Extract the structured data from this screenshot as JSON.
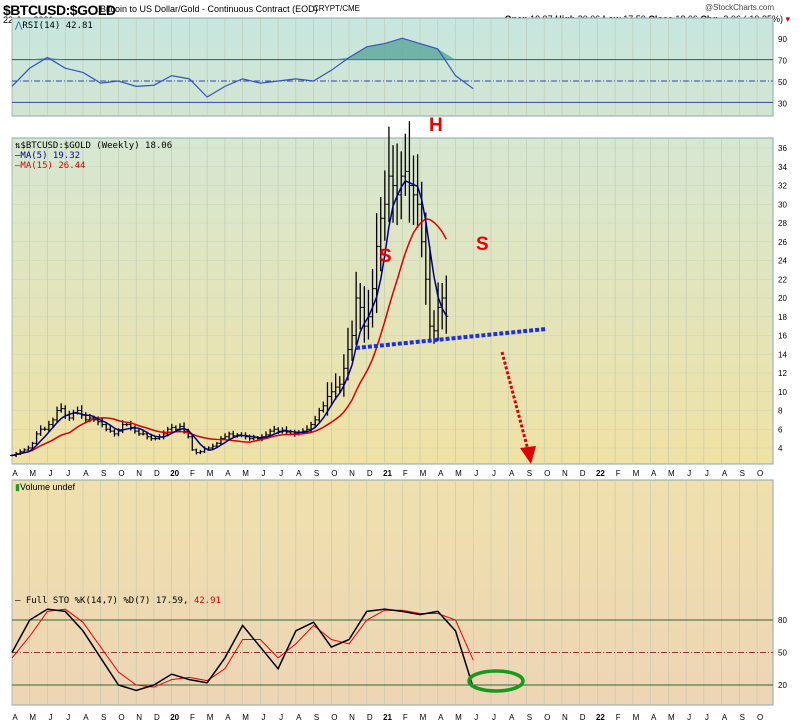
{
  "header": {
    "symbol": "$BTCUSD:$GOLD",
    "description": "Bitcoin to US Dollar/Gold - Continuous Contract (EOD)",
    "exchange": "CRYPT/CME",
    "date": "22-Jun-2021",
    "watermark": "@StockCharts.com",
    "open_label": "Open",
    "open": "19.97",
    "high_label": "High",
    "high": "20.06",
    "low_label": "Low",
    "low": "17.50",
    "close_label": "Close",
    "close": "18.06",
    "chg_label": "Chg",
    "chg": "-2.06 (-10.25%)"
  },
  "rsi_panel": {
    "label": "RSI(14) 42.81"
  },
  "price_panel": {
    "label": "$BTCUSD:$GOLD (Weekly) 18.06",
    "ma5": "MA(5) 19.32",
    "ma15": "MA(15) 26.44"
  },
  "volume_panel": {
    "label": "Volume undef"
  },
  "sto_panel": {
    "label": "Full STO %K(14,7) %D(7) 17.59,",
    "d_value": "42.91"
  },
  "annotations": {
    "left_shoulder": "S",
    "head": "H",
    "right_shoulder": "S"
  },
  "colors": {
    "ma5": "#00008b",
    "ma15": "#dd0000",
    "neckline": "#1e2fe0",
    "arrow": "#e00000",
    "ellipse": "#159a1e"
  },
  "chart_data": [
    {
      "type": "line",
      "name": "RSI(14)",
      "ylim": [
        20,
        100
      ],
      "yticks": [
        90,
        70,
        50,
        30
      ],
      "reference_lines": [
        70,
        50,
        30
      ],
      "monthly_values": [
        45,
        62,
        72,
        62,
        58,
        48,
        50,
        45,
        46,
        55,
        52,
        35,
        45,
        52,
        48,
        50,
        52,
        50,
        60,
        72,
        82,
        85,
        90,
        85,
        80,
        55,
        42.81
      ]
    },
    {
      "type": "ohlc",
      "name": "$BTCUSD:$GOLD Weekly",
      "start": "Apr 2019",
      "end": "22-Jun-2021",
      "ylim": [
        2,
        37
      ],
      "yticks": [
        4,
        6,
        8,
        10,
        12,
        14,
        16,
        18,
        20,
        22,
        24,
        26,
        28,
        30,
        32,
        34,
        36
      ],
      "weekly_close": [
        3.2,
        3.4,
        3.6,
        3.8,
        4.0,
        4.5,
        5.5,
        6.0,
        6.0,
        6.5,
        7.0,
        8.0,
        8.2,
        7.5,
        7.2,
        7.8,
        8.0,
        7.5,
        7.0,
        7.2,
        7.0,
        6.8,
        6.5,
        6.0,
        5.8,
        5.5,
        5.8,
        6.5,
        6.5,
        6.2,
        5.8,
        5.5,
        5.5,
        5.2,
        5.0,
        5.0,
        5.2,
        5.5,
        6.0,
        6.2,
        6.0,
        6.3,
        5.8,
        5.2,
        3.8,
        3.5,
        3.6,
        3.9,
        4.0,
        4.2,
        4.5,
        5.0,
        5.2,
        5.5,
        5.3,
        5.4,
        5.3,
        5.2,
        5.0,
        5.1,
        5.0,
        5.2,
        5.4,
        5.8,
        6.0,
        5.8,
        5.9,
        5.7,
        5.5,
        5.6,
        5.7,
        5.8,
        6.0,
        6.5,
        7.0,
        8.0,
        8.5,
        9.5,
        10.0,
        10.5,
        10.8,
        12.5,
        14.5,
        16.0,
        20.0,
        19.0,
        17.0,
        18.0,
        21.0,
        25.5,
        28.5,
        30.0,
        33.0,
        32.0,
        31.0,
        33.0,
        33.5,
        32.0,
        31.0,
        30.0,
        26.0,
        22.0,
        17.0,
        16.5,
        19.0,
        20.0,
        18.06
      ]
    },
    {
      "type": "line",
      "name": "Full STO",
      "ylim": [
        0,
        100
      ],
      "yticks": [
        80,
        50,
        20
      ],
      "k_monthly": [
        50,
        80,
        90,
        88,
        70,
        45,
        20,
        15,
        20,
        30,
        25,
        22,
        45,
        75,
        55,
        35,
        70,
        78,
        55,
        62,
        88,
        90,
        88,
        85,
        88,
        70,
        17.59
      ],
      "d_monthly": [
        45,
        65,
        88,
        90,
        78,
        55,
        32,
        20,
        18,
        25,
        27,
        24,
        35,
        62,
        62,
        45,
        58,
        75,
        62,
        58,
        80,
        89,
        89,
        86,
        86,
        80,
        42.91
      ]
    }
  ],
  "x_axis": {
    "labels": [
      "A",
      "M",
      "J",
      "J",
      "A",
      "S",
      "O",
      "N",
      "D",
      "20",
      "F",
      "M",
      "A",
      "M",
      "J",
      "J",
      "A",
      "S",
      "O",
      "N",
      "D",
      "21",
      "F",
      "M",
      "A",
      "M",
      "J",
      "J",
      "A",
      "S",
      "O",
      "N",
      "D",
      "22",
      "F",
      "M",
      "A",
      "M",
      "J",
      "J",
      "A",
      "S",
      "O"
    ]
  }
}
